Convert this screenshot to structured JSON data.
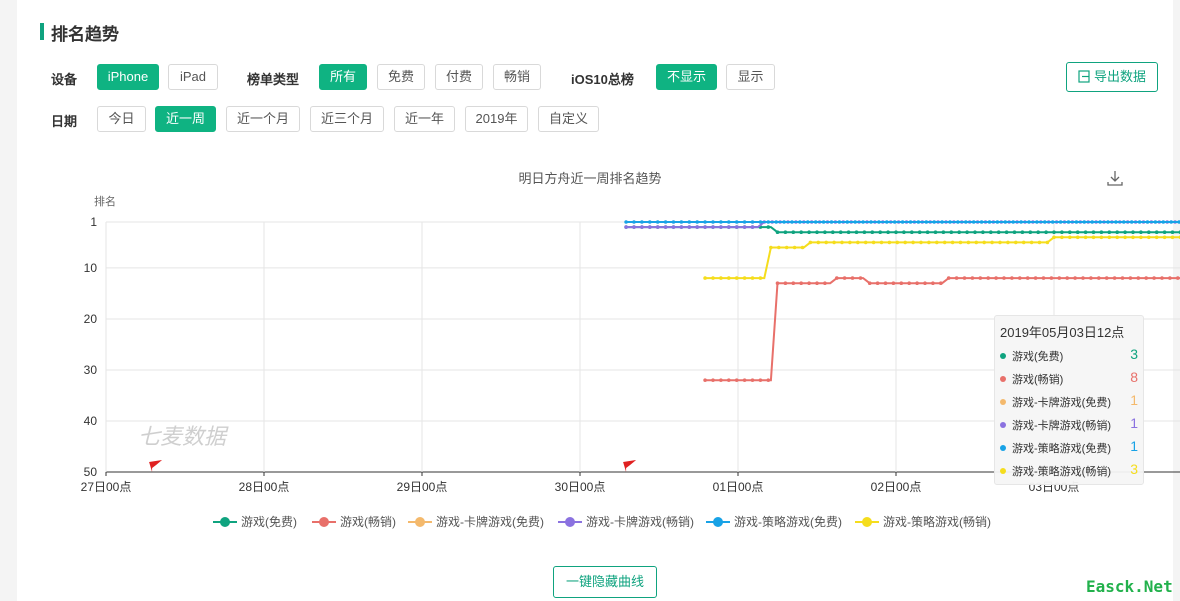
{
  "page": {
    "title": "排名趋势",
    "export_label": "导出数据",
    "hide_lines_label": "一键隐藏曲线",
    "watermark": "Easck.Net"
  },
  "filters": {
    "device": {
      "label": "设备",
      "options": [
        "iPhone",
        "iPad"
      ],
      "active": 0
    },
    "list_type": {
      "label": "榜单类型",
      "options": [
        "所有",
        "免费",
        "付费",
        "畅销"
      ],
      "active": 0
    },
    "ios10": {
      "label": "iOS10总榜",
      "options": [
        "不显示",
        "显示"
      ],
      "active": 0
    },
    "date": {
      "label": "日期",
      "options": [
        "今日",
        "近一周",
        "近一个月",
        "近三个月",
        "近一年",
        "2019年",
        "自定义"
      ],
      "active": 1
    }
  },
  "colors": {
    "accent": "#0fb382",
    "series": [
      "#0fa37f",
      "#e8706a",
      "#f4b96c",
      "#8b72e0",
      "#18a2e6",
      "#f5dd1d"
    ]
  },
  "chart_data": {
    "type": "line",
    "title": "明日方舟近一周排名趋势",
    "ylabel": "排名",
    "y_inverted": true,
    "ylim": [
      1,
      50
    ],
    "yticks": [
      1,
      10,
      20,
      30,
      40,
      50
    ],
    "x_ticks": [
      "27日00点",
      "28日00点",
      "29日00点",
      "30日00点",
      "01日00点",
      "02日00点",
      "03日00点",
      "03日12点"
    ],
    "x_unit": "hours since 27日00点",
    "watermark": "七麦数据",
    "flags": [
      7,
      79
    ],
    "series": [
      {
        "name": "游戏(免费)",
        "points": [
          [
            79,
            2
          ],
          [
            101,
            2
          ],
          [
            102,
            3
          ],
          [
            184,
            3
          ],
          [
            185,
            4
          ],
          [
            191,
            4
          ],
          [
            192,
            5
          ],
          [
            200,
            5
          ],
          [
            201,
            4
          ],
          [
            204,
            4
          ],
          [
            204.5,
            3
          ]
        ]
      },
      {
        "name": "游戏(畅销)",
        "points": [
          [
            91,
            32
          ],
          [
            101,
            32
          ],
          [
            102,
            13
          ],
          [
            110,
            13
          ],
          [
            111,
            12
          ],
          [
            115,
            12
          ],
          [
            116,
            13
          ],
          [
            127,
            13
          ],
          [
            128,
            12
          ],
          [
            174,
            12
          ],
          [
            175,
            10
          ],
          [
            180,
            10
          ],
          [
            181,
            9
          ],
          [
            186,
            9
          ],
          [
            187,
            8
          ],
          [
            204.5,
            8
          ]
        ]
      },
      {
        "name": "游戏-卡牌游戏(免费)",
        "points": []
      },
      {
        "name": "游戏-卡牌游戏(畅销)",
        "points": [
          [
            79,
            2
          ],
          [
            99,
            2
          ],
          [
            100,
            1
          ],
          [
            204.5,
            1
          ]
        ]
      },
      {
        "name": "游戏-策略游戏(免费)",
        "points": [
          [
            79,
            1
          ],
          [
            174,
            1
          ],
          [
            175,
            2
          ],
          [
            204.5,
            2
          ],
          [
            204.5,
            1
          ]
        ]
      },
      {
        "name": "游戏-策略游戏(畅销)",
        "points": [
          [
            91,
            12
          ],
          [
            100,
            12
          ],
          [
            101,
            6
          ],
          [
            106,
            6
          ],
          [
            107,
            5
          ],
          [
            143,
            5
          ],
          [
            144,
            4
          ],
          [
            204.5,
            4
          ],
          [
            204.5,
            3
          ]
        ]
      }
    ],
    "tooltip": {
      "title": "2019年05月03日12点",
      "values": [
        "3",
        "8",
        "1",
        "1",
        "1",
        "3"
      ]
    }
  }
}
